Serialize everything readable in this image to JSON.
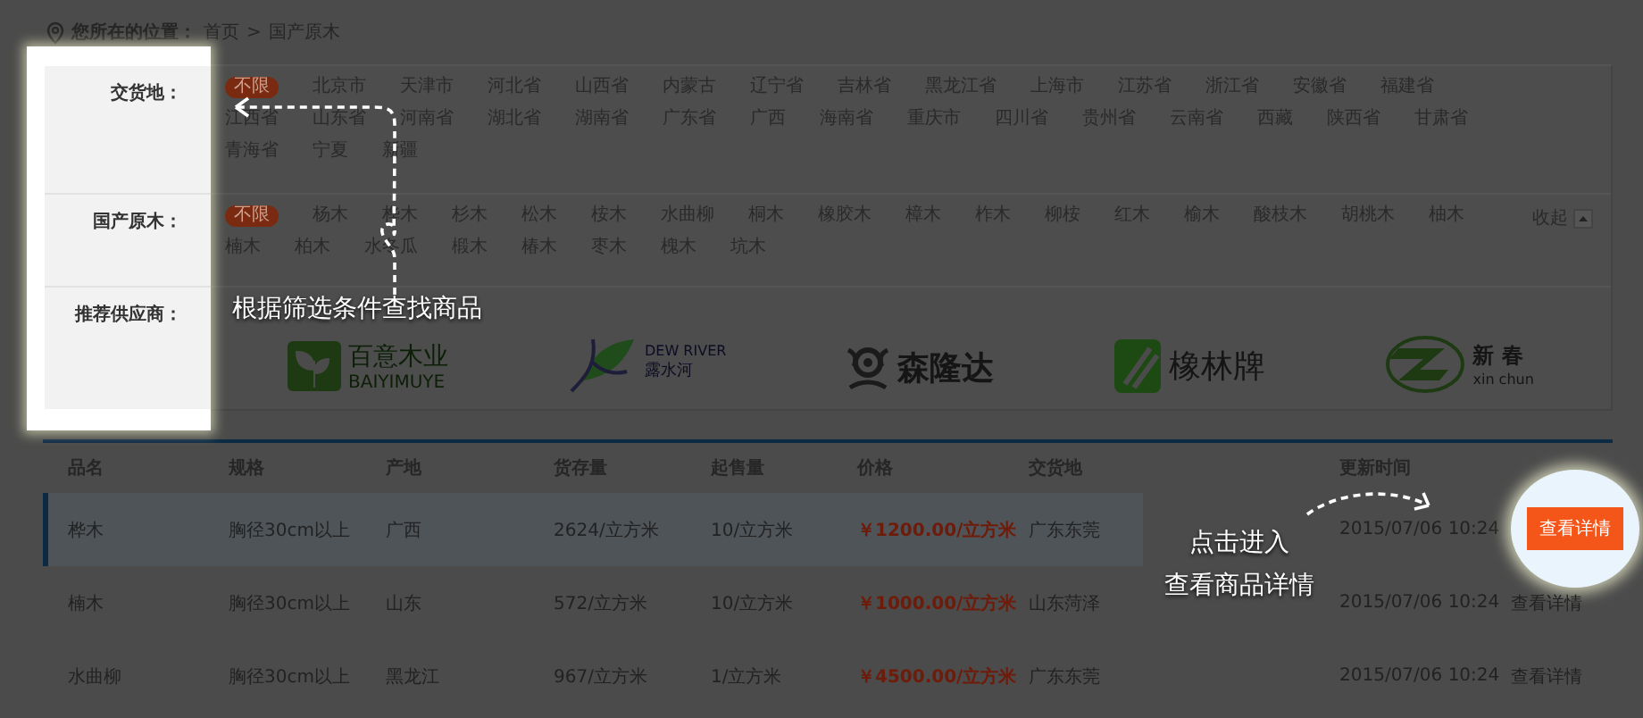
{
  "breadcrumb": {
    "label": "您所在的位置：",
    "items": [
      "首页",
      "国产原木"
    ],
    "separator": ">"
  },
  "filters": [
    {
      "label": "交货地：",
      "options": [
        {
          "text": "不限",
          "selected": true
        },
        {
          "text": "北京市",
          "selected": false
        },
        {
          "text": "天津市",
          "selected": false
        },
        {
          "text": "河北省",
          "selected": false
        },
        {
          "text": "山西省",
          "selected": false
        },
        {
          "text": "内蒙古",
          "selected": false
        },
        {
          "text": "辽宁省",
          "selected": false
        },
        {
          "text": "吉林省",
          "selected": false
        },
        {
          "text": "黑龙江省",
          "selected": false
        },
        {
          "text": "上海市",
          "selected": false
        },
        {
          "text": "江苏省",
          "selected": false
        },
        {
          "text": "浙江省",
          "selected": false
        },
        {
          "text": "安徽省",
          "selected": false
        },
        {
          "text": "福建省",
          "selected": false
        },
        {
          "text": "江西省",
          "selected": false
        },
        {
          "text": "山东省",
          "selected": false
        },
        {
          "text": "河南省",
          "selected": false
        },
        {
          "text": "湖北省",
          "selected": false
        },
        {
          "text": "湖南省",
          "selected": false
        },
        {
          "text": "广东省",
          "selected": false
        },
        {
          "text": "广西",
          "selected": false
        },
        {
          "text": "海南省",
          "selected": false
        },
        {
          "text": "重庆市",
          "selected": false
        },
        {
          "text": "四川省",
          "selected": false
        },
        {
          "text": "贵州省",
          "selected": false
        },
        {
          "text": "云南省",
          "selected": false
        },
        {
          "text": "西藏",
          "selected": false
        },
        {
          "text": "陕西省",
          "selected": false
        },
        {
          "text": "甘肃省",
          "selected": false
        },
        {
          "text": "青海省",
          "selected": false
        },
        {
          "text": "宁夏",
          "selected": false
        },
        {
          "text": "新疆",
          "selected": false
        }
      ]
    },
    {
      "label": "国产原木：",
      "toggle": "收起",
      "options": [
        {
          "text": "不限",
          "selected": true
        },
        {
          "text": "杨木",
          "selected": false
        },
        {
          "text": "桦木",
          "selected": false
        },
        {
          "text": "杉木",
          "selected": false
        },
        {
          "text": "松木",
          "selected": false
        },
        {
          "text": "桉木",
          "selected": false
        },
        {
          "text": "水曲柳",
          "selected": false
        },
        {
          "text": "桐木",
          "selected": false
        },
        {
          "text": "橡胶木",
          "selected": false
        },
        {
          "text": "樟木",
          "selected": false
        },
        {
          "text": "柞木",
          "selected": false
        },
        {
          "text": "柳桉",
          "selected": false
        },
        {
          "text": "红木",
          "selected": false
        },
        {
          "text": "榆木",
          "selected": false
        },
        {
          "text": "酸枝木",
          "selected": false
        },
        {
          "text": "胡桃木",
          "selected": false
        },
        {
          "text": "柚木",
          "selected": false
        },
        {
          "text": "楠木",
          "selected": false
        },
        {
          "text": "柏木",
          "selected": false
        },
        {
          "text": "水冬瓜",
          "selected": false
        },
        {
          "text": "椴木",
          "selected": false
        },
        {
          "text": "椿木",
          "selected": false
        },
        {
          "text": "枣木",
          "selected": false
        },
        {
          "text": "槐木",
          "selected": false
        },
        {
          "text": "坑木",
          "selected": false
        }
      ]
    }
  ],
  "suppliers": {
    "label": "推荐供应商：",
    "logos": [
      {
        "kind": "leaf",
        "texts": [
          "百意木业",
          "BAIYIMUYE"
        ]
      },
      {
        "kind": "swirl-leaf",
        "texts": [
          "DEW RIVER",
          "露水河"
        ]
      },
      {
        "kind": "ornament",
        "texts": [
          "森隆达"
        ]
      },
      {
        "kind": "square",
        "texts": [
          "橡林牌"
        ]
      },
      {
        "kind": "ring",
        "texts": [
          "新 春",
          "xin chun"
        ]
      }
    ]
  },
  "table": {
    "columns": [
      "品名",
      "规格",
      "产地",
      "货存量",
      "起售量",
      "价格",
      "交货地",
      "更新时间"
    ],
    "rows": [
      {
        "selected": true,
        "cells": [
          "桦木",
          "胸径30cm以上",
          "广西",
          "2624/立方米",
          "10/立方米",
          "￥1200.00/立方米",
          "广东东莞",
          "2015/07/06 10:24"
        ],
        "action": {
          "kind": "button",
          "text": "查看详情"
        }
      },
      {
        "selected": false,
        "cells": [
          "楠木",
          "胸径30cm以上",
          "山东",
          "572/立方米",
          "10/立方米",
          "￥1000.00/立方米",
          "山东菏泽",
          "2015/07/06 10:24"
        ],
        "action": {
          "kind": "link",
          "text": "查看详情"
        }
      },
      {
        "selected": false,
        "cells": [
          "水曲柳",
          "胸径30cm以上",
          "黑龙江",
          "967/立方米",
          "1/立方米",
          "￥4500.00/立方米",
          "广东东莞",
          "2015/07/06 10:24"
        ],
        "action": {
          "kind": "link",
          "text": "查看详情"
        }
      }
    ]
  },
  "annotations": [
    {
      "kind": "filters",
      "lines": [
        "根据筛选条件查找商品"
      ]
    },
    {
      "kind": "details",
      "lines": [
        "点击进入",
        "查看商品详情"
      ]
    }
  ]
}
